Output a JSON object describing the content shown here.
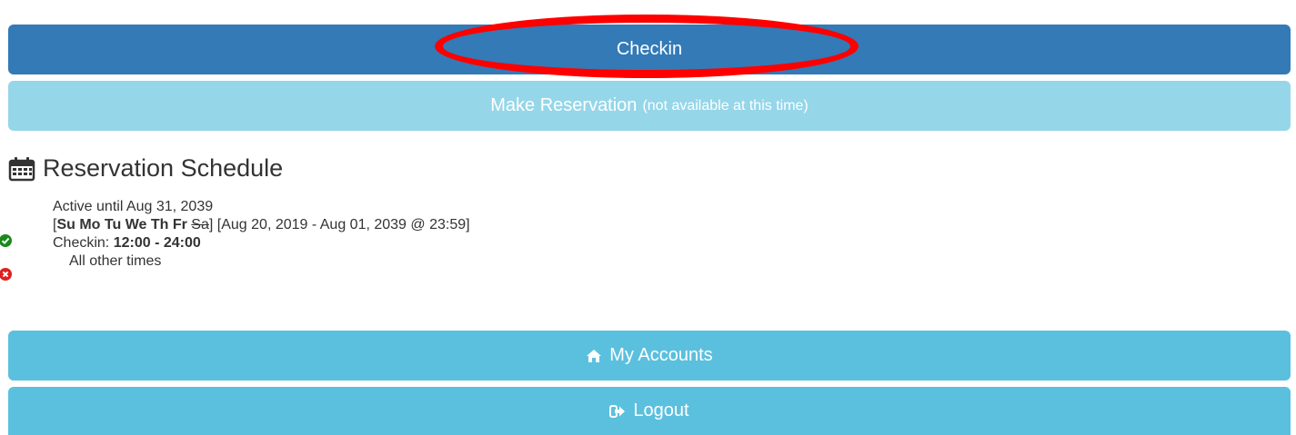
{
  "buttons": {
    "checkin": "Checkin",
    "make_reservation": "Make Reservation",
    "make_reservation_note": "(not available at this time)",
    "my_accounts": "My Accounts",
    "logout": "Logout"
  },
  "schedule": {
    "title": "Reservation Schedule",
    "active_until": "Active until Aug 31, 2039",
    "rule": {
      "bracket_open": "[",
      "days_enabled": "Su Mo Tu We Th Fr",
      "days_disabled": "Sa",
      "bracket_close": "]",
      "date_range": "[Aug 20, 2019 - Aug 01, 2039 @ 23:59]",
      "checkin_label": "Checkin:",
      "checkin_hours": "12:00 - 24:00"
    },
    "other_times": "All other times"
  },
  "colors": {
    "primary": "#337ab7",
    "info": "#5bc0de",
    "info_disabled": "#95d6e9",
    "success": "#1a8a1a",
    "danger": "#e02020",
    "annotation": "#ff0000"
  },
  "icons": {
    "calendar": "calendar-icon",
    "home": "home-icon",
    "logout": "logout-icon",
    "check": "check-circle-icon",
    "cross": "times-circle-icon"
  }
}
